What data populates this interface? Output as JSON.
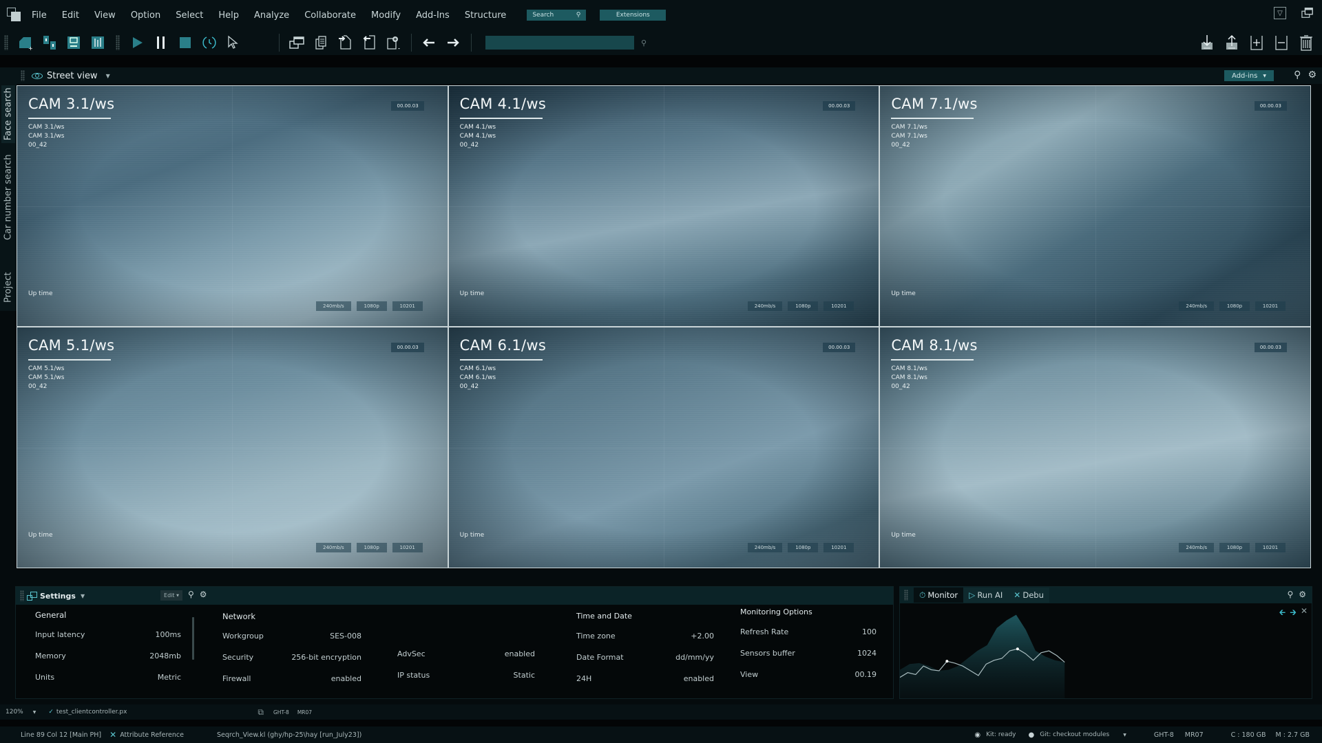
{
  "menubar": {
    "items": [
      "File",
      "Edit",
      "View",
      "Option",
      "Select",
      "Help",
      "Analyze",
      "Collaborate",
      "Modify",
      "Add-Ins",
      "Structure"
    ],
    "search_label": "Search",
    "extensions_label": "Extensions"
  },
  "toolbar": {
    "left_icons": [
      "new-shape-icon",
      "component-icon",
      "save-icon",
      "equalizer-icon"
    ],
    "playback_icons": [
      "play-icon",
      "pause-icon",
      "stop-icon",
      "sync-icon",
      "pointer-icon"
    ],
    "file_icons": [
      "window-stack-icon",
      "copy-document-icon",
      "import-file-icon",
      "export-file-icon",
      "add-file-icon"
    ],
    "nav_icons": [
      "arrow-left-icon",
      "arrow-right-icon"
    ],
    "search_value": "",
    "right_icons": [
      "download-icon",
      "upload-icon",
      "add-panel-icon",
      "remove-panel-icon",
      "trash-icon"
    ]
  },
  "view": {
    "title": "Street view",
    "addins_label": "Add-ins"
  },
  "side_tabs": [
    "Face search",
    "Car number search",
    "Project"
  ],
  "cameras": [
    {
      "title": "CAM 3.1/ws",
      "sub1": "CAM 3.1/ws",
      "sub2": "CAM 3.1/ws",
      "sub3": "00_42",
      "time": "00.00.03",
      "uptime": "Up time",
      "bitrate": "240mb/s",
      "resolution": "1080p",
      "id": "10201"
    },
    {
      "title": "CAM 4.1/ws",
      "sub1": "CAM 4.1/ws",
      "sub2": "CAM 4.1/ws",
      "sub3": "00_42",
      "time": "00.00.03",
      "uptime": "Up time",
      "bitrate": "240mb/s",
      "resolution": "1080p",
      "id": "10201"
    },
    {
      "title": "CAM 7.1/ws",
      "sub1": "CAM 7.1/ws",
      "sub2": "CAM 7.1/ws",
      "sub3": "00_42",
      "time": "00.00.03",
      "uptime": "Up time",
      "bitrate": "240mb/s",
      "resolution": "1080p",
      "id": "10201"
    },
    {
      "title": "CAM 5.1/ws",
      "sub1": "CAM 5.1/ws",
      "sub2": "CAM 5.1/ws",
      "sub3": "00_42",
      "time": "00.00.03",
      "uptime": "Up time",
      "bitrate": "240mb/s",
      "resolution": "1080p",
      "id": "10201"
    },
    {
      "title": "CAM 6.1/ws",
      "sub1": "CAM 6.1/ws",
      "sub2": "CAM 6.1/ws",
      "sub3": "00_42",
      "time": "00.00.03",
      "uptime": "Up time",
      "bitrate": "240mb/s",
      "resolution": "1080p",
      "id": "10201"
    },
    {
      "title": "CAM 8.1/ws",
      "sub1": "CAM 8.1/ws",
      "sub2": "CAM 8.1/ws",
      "sub3": "00_42",
      "time": "00.00.03",
      "uptime": "Up time",
      "bitrate": "240mb/s",
      "resolution": "1080p",
      "id": "10201"
    }
  ],
  "settings": {
    "title": "Settings",
    "edit_label": "Edit",
    "general": {
      "title": "General",
      "rows": [
        {
          "key": "Input latency",
          "value": "100ms"
        },
        {
          "key": "Memory",
          "value": "2048mb"
        },
        {
          "key": "Units",
          "value": "Metric"
        }
      ]
    },
    "network": {
      "title": "Network",
      "rows": [
        {
          "key": "Workgroup",
          "value": "SES-008"
        },
        {
          "key": "Security",
          "value": "256-bit encryption"
        },
        {
          "key": "Firewall",
          "value": "enabled"
        }
      ]
    },
    "advanced": {
      "rows": [
        {
          "key": "AdvSec",
          "value": "enabled"
        },
        {
          "key": "IP status",
          "value": "Static"
        }
      ]
    },
    "time_date": {
      "title": "Time and Date",
      "rows": [
        {
          "key": "Time zone",
          "value": "+2.00"
        },
        {
          "key": "Date Format",
          "value": "dd/mm/yy"
        },
        {
          "key": "24H",
          "value": "enabled"
        }
      ]
    },
    "monitoring": {
      "title": "Monitoring Options",
      "rows": [
        {
          "key": "Refresh Rate",
          "value": "100"
        },
        {
          "key": "Sensors buffer",
          "value": "1024"
        },
        {
          "key": "View",
          "value": "00.19"
        }
      ]
    }
  },
  "monitor": {
    "tabs": [
      {
        "label": "Monitor",
        "icon": "timer-icon"
      },
      {
        "label": "Run AI",
        "icon": "play-outline-icon"
      },
      {
        "label": "Debu",
        "icon": "close-x-icon"
      }
    ],
    "line_values": [
      0.22,
      0.27,
      0.25,
      0.34,
      0.3,
      0.29,
      0.39,
      0.37,
      0.34,
      0.29,
      0.24,
      0.36,
      0.4,
      0.42,
      0.5,
      0.52,
      0.47,
      0.4,
      0.48,
      0.5,
      0.45,
      0.38
    ],
    "area_values": [
      0.3,
      0.36,
      0.37,
      0.34,
      0.29,
      0.3,
      0.34,
      0.42,
      0.5,
      0.56,
      0.74,
      0.82,
      0.88,
      0.72,
      0.5,
      0.44,
      0.4,
      0.38
    ],
    "highlight_points": [
      6,
      15
    ]
  },
  "status_top": {
    "zoom": "120%",
    "file": "test_clientcontroller.px",
    "branch": "GHT-8",
    "mr": "MR07"
  },
  "status_bottom": {
    "position": "Line 89 Col 12 [Main PH]",
    "attribute": "Attribute Reference",
    "path": "Seqrch_View.kl (ghy/hp-25\\hay [run_July23])",
    "kit": "Kit: ready",
    "git": "Git: checkout modules",
    "branch": "GHT-8",
    "mr": "MR07",
    "disk_c": "C : 180 GB",
    "mem": "M : 2.7 GB"
  },
  "colors": {
    "accent": "#1d5a60",
    "accent_bright": "#5bc6d0",
    "panel_header": "#0b2327",
    "background": "#050b0d"
  }
}
